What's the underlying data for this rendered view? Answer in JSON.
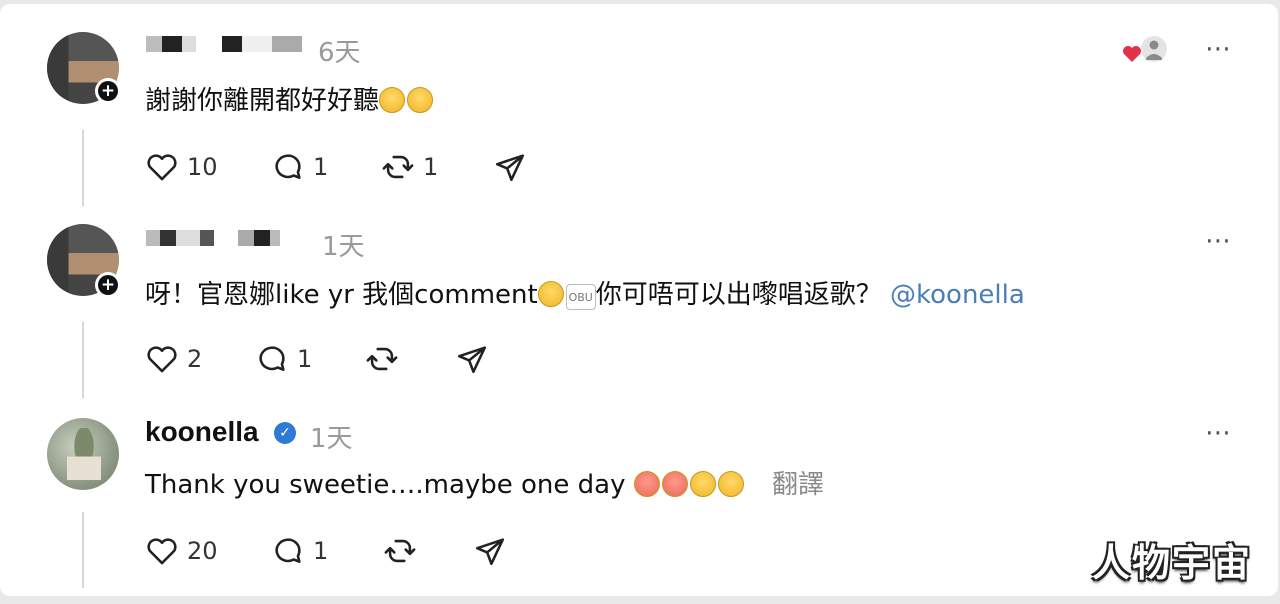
{
  "posts": [
    {
      "time": "6天",
      "text": "謝謝你離開都好好聽",
      "likes": "10",
      "replies": "1",
      "reposts": "1",
      "more": "⋯"
    },
    {
      "time": "1天",
      "text": "呀！官恩娜like yr 我個comment",
      "text2": "你可唔可以出嚟唱返歌？",
      "mention": "@koonella",
      "emoji_label": "OBU",
      "likes": "2",
      "replies": "1",
      "more": "⋯"
    },
    {
      "username": "koonella",
      "time": "1天",
      "text": "Thank you sweetie….maybe one day",
      "translate": "翻譯",
      "likes": "20",
      "replies": "1",
      "more": "⋯"
    }
  ],
  "watermark": "人物宇宙",
  "colors": {
    "accent_blue": "#4a7fb5",
    "verified": "#2e7bd6",
    "heart": "#e0334a"
  }
}
